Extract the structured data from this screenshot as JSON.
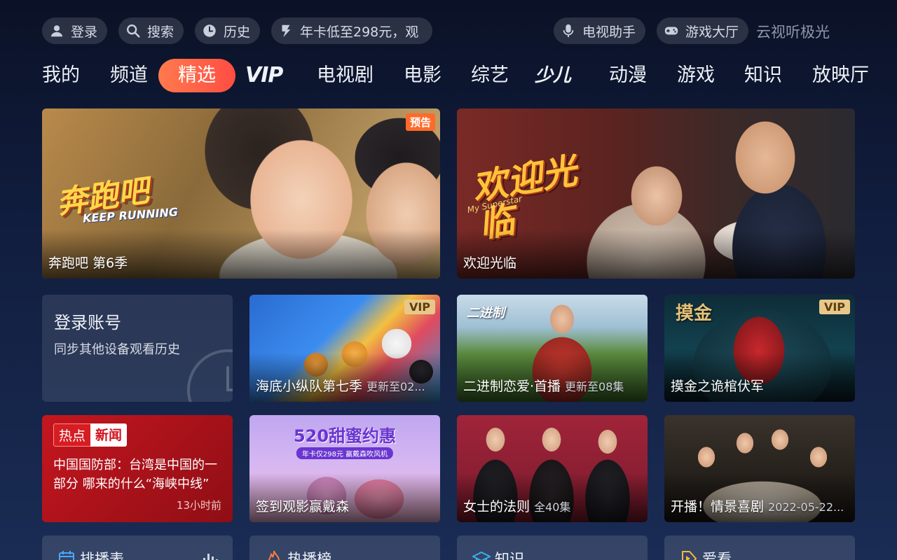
{
  "topbar": {
    "login": "登录",
    "search": "搜索",
    "history": "历史",
    "promo": "年卡低至298元，观",
    "tv_assistant": "电视助手",
    "game_hall": "游戏大厅",
    "brand": "云视听极光"
  },
  "nav": {
    "tabs": [
      "我的",
      "频道",
      "精选",
      "VIP",
      "电视剧",
      "电影",
      "综艺",
      "少儿",
      "动漫",
      "游戏",
      "知识",
      "放映厅"
    ],
    "active_index": 2
  },
  "hero": [
    {
      "title": "奔跑吧 第6季",
      "badge": "预告",
      "logo_text": "奔跑吧",
      "logo_sub": "KEEP RUNNING"
    },
    {
      "title": "欢迎光临",
      "logo_text": "欢迎光临",
      "logo_sub": "My Superstar"
    }
  ],
  "login_card": {
    "title": "登录账号",
    "subtitle": "同步其他设备观看历史"
  },
  "row2": [
    {
      "title": "海底小纵队第七季",
      "sub": "更新至02...",
      "badge": "VIP"
    },
    {
      "title": "二进制恋爱·首播",
      "sub": "更新至08集"
    },
    {
      "title": "摸金之诡棺伏军",
      "badge": "VIP",
      "logo_text": "摸金"
    }
  ],
  "news_card": {
    "tag1": "热点",
    "tag2": "新闻",
    "headline": "中国国防部：台湾是中国的一部分 哪来的什么“海峡中线”",
    "time": "13小时前"
  },
  "row3": [
    {
      "title": "签到观影赢戴森",
      "promo_text": "520甜蜜约惠",
      "promo_sub": "年卡仅298元 赢戴森吹风机"
    },
    {
      "title": "女士的法则",
      "sub": "全40集"
    },
    {
      "title": "开播！情景喜剧",
      "sub": "2022-05-22..."
    }
  ],
  "bottom": [
    {
      "label": "排播表",
      "icon": "calendar-icon"
    },
    {
      "label": "热播榜",
      "icon": "fire-icon"
    },
    {
      "label": "知识",
      "icon": "graduation-cap-icon"
    },
    {
      "label": "爱看",
      "icon": "play-tag-icon"
    }
  ],
  "colors": {
    "accent": "#ff5a45",
    "vip_gold": "#e8c88a",
    "news_red": "#c5161f",
    "background": "#101c3c"
  }
}
